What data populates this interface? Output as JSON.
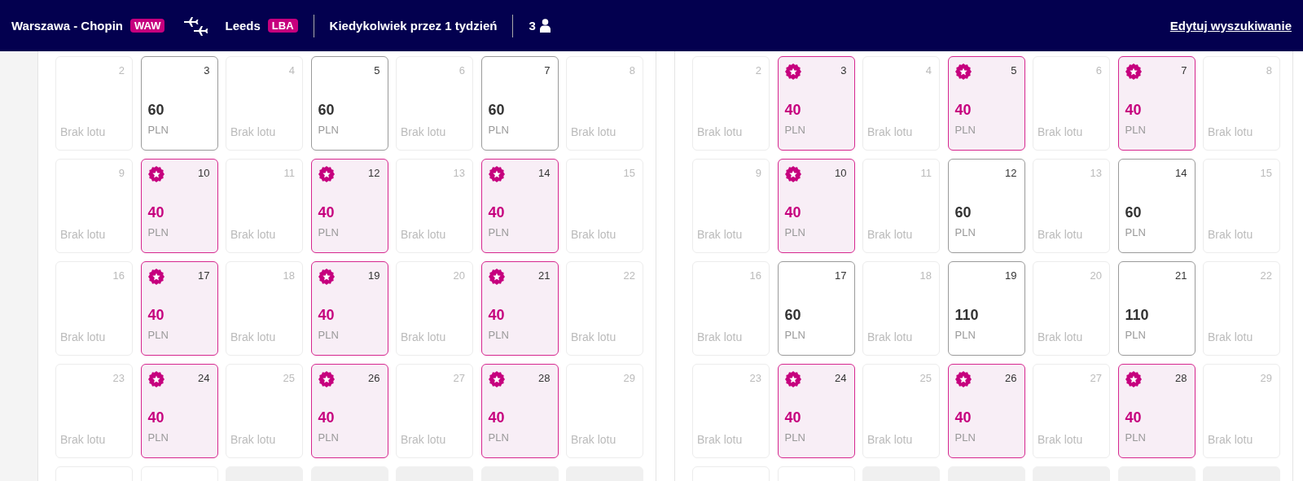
{
  "header": {
    "origin": "Warszawa - Chopin",
    "origin_code": "WAW",
    "destination": "Leeds",
    "destination_code": "LBA",
    "dates": "Kiedykolwiek przez 1 tydzień",
    "passengers": "3",
    "edit_link": "Edytuj wyszukiwanie"
  },
  "months": [
    {
      "days": [
        {
          "day": "2",
          "kind": "none",
          "label": "Brak lotu"
        },
        {
          "day": "3",
          "kind": "price",
          "price": "60",
          "currency": "PLN",
          "deal": false
        },
        {
          "day": "4",
          "kind": "none",
          "label": "Brak lotu"
        },
        {
          "day": "5",
          "kind": "price",
          "price": "60",
          "currency": "PLN",
          "deal": false
        },
        {
          "day": "6",
          "kind": "none",
          "label": "Brak lotu"
        },
        {
          "day": "7",
          "kind": "price",
          "price": "60",
          "currency": "PLN",
          "deal": false
        },
        {
          "day": "8",
          "kind": "none",
          "label": "Brak lotu"
        },
        {
          "day": "9",
          "kind": "none",
          "label": "Brak lotu"
        },
        {
          "day": "10",
          "kind": "price",
          "price": "40",
          "currency": "PLN",
          "deal": true
        },
        {
          "day": "11",
          "kind": "none",
          "label": "Brak lotu"
        },
        {
          "day": "12",
          "kind": "price",
          "price": "40",
          "currency": "PLN",
          "deal": true
        },
        {
          "day": "13",
          "kind": "none",
          "label": "Brak lotu"
        },
        {
          "day": "14",
          "kind": "price",
          "price": "40",
          "currency": "PLN",
          "deal": true
        },
        {
          "day": "15",
          "kind": "none",
          "label": "Brak lotu"
        },
        {
          "day": "16",
          "kind": "none",
          "label": "Brak lotu"
        },
        {
          "day": "17",
          "kind": "price",
          "price": "40",
          "currency": "PLN",
          "deal": true
        },
        {
          "day": "18",
          "kind": "none",
          "label": "Brak lotu"
        },
        {
          "day": "19",
          "kind": "price",
          "price": "40",
          "currency": "PLN",
          "deal": true
        },
        {
          "day": "20",
          "kind": "none",
          "label": "Brak lotu"
        },
        {
          "day": "21",
          "kind": "price",
          "price": "40",
          "currency": "PLN",
          "deal": true
        },
        {
          "day": "22",
          "kind": "none",
          "label": "Brak lotu"
        },
        {
          "day": "23",
          "kind": "none",
          "label": "Brak lotu"
        },
        {
          "day": "24",
          "kind": "price",
          "price": "40",
          "currency": "PLN",
          "deal": true
        },
        {
          "day": "25",
          "kind": "none",
          "label": "Brak lotu"
        },
        {
          "day": "26",
          "kind": "price",
          "price": "40",
          "currency": "PLN",
          "deal": true
        },
        {
          "day": "27",
          "kind": "none",
          "label": "Brak lotu"
        },
        {
          "day": "28",
          "kind": "price",
          "price": "40",
          "currency": "PLN",
          "deal": true
        },
        {
          "day": "29",
          "kind": "none",
          "label": "Brak lotu"
        },
        {
          "kind": "blank"
        },
        {
          "kind": "blank"
        },
        {
          "kind": "filler"
        },
        {
          "kind": "filler"
        },
        {
          "kind": "filler"
        },
        {
          "kind": "filler"
        },
        {
          "kind": "filler"
        }
      ]
    },
    {
      "days": [
        {
          "day": "2",
          "kind": "none",
          "label": "Brak lotu"
        },
        {
          "day": "3",
          "kind": "price",
          "price": "40",
          "currency": "PLN",
          "deal": true
        },
        {
          "day": "4",
          "kind": "none",
          "label": "Brak lotu"
        },
        {
          "day": "5",
          "kind": "price",
          "price": "40",
          "currency": "PLN",
          "deal": true
        },
        {
          "day": "6",
          "kind": "none",
          "label": "Brak lotu"
        },
        {
          "day": "7",
          "kind": "price",
          "price": "40",
          "currency": "PLN",
          "deal": true
        },
        {
          "day": "8",
          "kind": "none",
          "label": "Brak lotu"
        },
        {
          "day": "9",
          "kind": "none",
          "label": "Brak lotu"
        },
        {
          "day": "10",
          "kind": "price",
          "price": "40",
          "currency": "PLN",
          "deal": true
        },
        {
          "day": "11",
          "kind": "none",
          "label": "Brak lotu"
        },
        {
          "day": "12",
          "kind": "price",
          "price": "60",
          "currency": "PLN",
          "deal": false
        },
        {
          "day": "13",
          "kind": "none",
          "label": "Brak lotu"
        },
        {
          "day": "14",
          "kind": "price",
          "price": "60",
          "currency": "PLN",
          "deal": false
        },
        {
          "day": "15",
          "kind": "none",
          "label": "Brak lotu"
        },
        {
          "day": "16",
          "kind": "none",
          "label": "Brak lotu"
        },
        {
          "day": "17",
          "kind": "price",
          "price": "60",
          "currency": "PLN",
          "deal": false
        },
        {
          "day": "18",
          "kind": "none",
          "label": "Brak lotu"
        },
        {
          "day": "19",
          "kind": "price",
          "price": "110",
          "currency": "PLN",
          "deal": false
        },
        {
          "day": "20",
          "kind": "none",
          "label": "Brak lotu"
        },
        {
          "day": "21",
          "kind": "price",
          "price": "110",
          "currency": "PLN",
          "deal": false
        },
        {
          "day": "22",
          "kind": "none",
          "label": "Brak lotu"
        },
        {
          "day": "23",
          "kind": "none",
          "label": "Brak lotu"
        },
        {
          "day": "24",
          "kind": "price",
          "price": "40",
          "currency": "PLN",
          "deal": true
        },
        {
          "day": "25",
          "kind": "none",
          "label": "Brak lotu"
        },
        {
          "day": "26",
          "kind": "price",
          "price": "40",
          "currency": "PLN",
          "deal": true
        },
        {
          "day": "27",
          "kind": "none",
          "label": "Brak lotu"
        },
        {
          "day": "28",
          "kind": "price",
          "price": "40",
          "currency": "PLN",
          "deal": true
        },
        {
          "day": "29",
          "kind": "none",
          "label": "Brak lotu"
        },
        {
          "kind": "blank"
        },
        {
          "kind": "blank"
        },
        {
          "kind": "filler"
        },
        {
          "kind": "filler"
        },
        {
          "kind": "filler"
        },
        {
          "kind": "filler"
        },
        {
          "kind": "filler"
        }
      ]
    }
  ]
}
